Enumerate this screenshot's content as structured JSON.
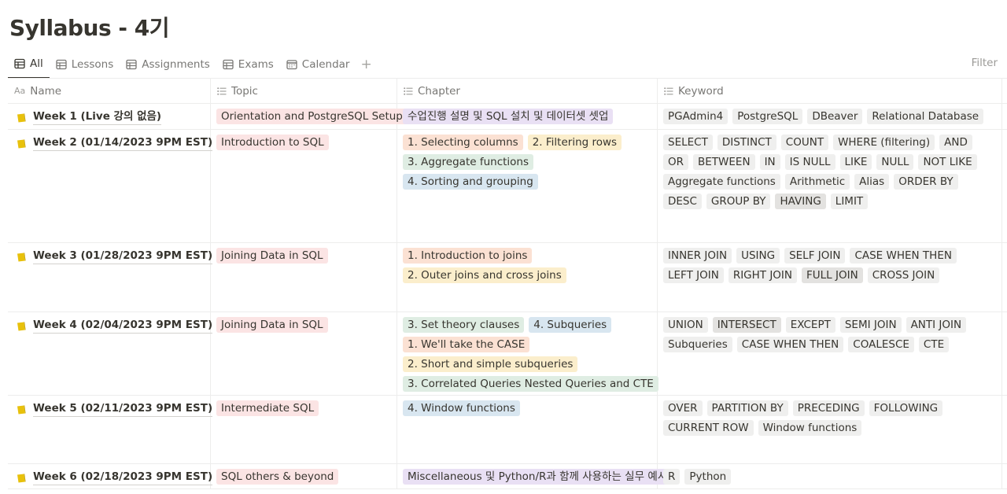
{
  "title": "Syllabus - 4기",
  "tabs": [
    {
      "label": "All",
      "icon": "table-icon",
      "active": true
    },
    {
      "label": "Lessons",
      "icon": "table-icon"
    },
    {
      "label": "Assignments",
      "icon": "table-icon"
    },
    {
      "label": "Exams",
      "icon": "table-icon"
    },
    {
      "label": "Calendar",
      "icon": "calendar-icon"
    }
  ],
  "add_view_label": "+",
  "filter_label": "Filter",
  "columns": {
    "name": {
      "label": "Name",
      "icon": "Aa"
    },
    "topic": {
      "label": "Topic",
      "icon": "list-icon"
    },
    "chapter": {
      "label": "Chapter",
      "icon": "list-icon"
    },
    "keyword": {
      "label": "Keyword",
      "icon": "list-icon"
    }
  },
  "colors": {
    "page_icon": "#e8c10c",
    "text": "#37352f",
    "muted": "#787774"
  },
  "rows": [
    {
      "name": "Week 1 (Live 강의 없음)",
      "topic": [
        {
          "label": "Orientation and PostgreSQL Setup",
          "color": "red"
        }
      ],
      "chapter": [
        {
          "label": "수업진행 설명 및 SQL 설치 및 데이터셋 셋업",
          "color": "purple"
        }
      ],
      "keywords": [
        {
          "label": "PGAdmin4",
          "color": "gray"
        },
        {
          "label": "PostgreSQL",
          "color": "gray"
        },
        {
          "label": "DBeaver",
          "color": "gray"
        },
        {
          "label": "Relational Database",
          "color": "gray"
        }
      ]
    },
    {
      "name": "Week 2 (01/14/2023 9PM EST)",
      "topic": [
        {
          "label": "Introduction to SQL",
          "color": "red"
        }
      ],
      "chapter": [
        {
          "label": "1. Selecting columns",
          "color": "orange"
        },
        {
          "label": "2. Filtering rows",
          "color": "yellow"
        },
        {
          "label": "3. Aggregate functions",
          "color": "green"
        },
        {
          "label": "4. Sorting and grouping",
          "color": "blue"
        }
      ],
      "keywords": [
        {
          "label": "SELECT",
          "color": "gray"
        },
        {
          "label": "DISTINCT",
          "color": "gray"
        },
        {
          "label": "COUNT",
          "color": "gray"
        },
        {
          "label": "WHERE (filtering)",
          "color": "gray"
        },
        {
          "label": "AND",
          "color": "gray"
        },
        {
          "label": "OR",
          "color": "gray"
        },
        {
          "label": "BETWEEN",
          "color": "gray"
        },
        {
          "label": "IN",
          "color": "gray"
        },
        {
          "label": "IS NULL",
          "color": "gray"
        },
        {
          "label": "LIKE",
          "color": "gray"
        },
        {
          "label": "NULL",
          "color": "gray"
        },
        {
          "label": "NOT LIKE",
          "color": "gray"
        },
        {
          "label": "Aggregate functions",
          "color": "gray"
        },
        {
          "label": "Arithmetic",
          "color": "gray"
        },
        {
          "label": "Alias",
          "color": "gray"
        },
        {
          "label": "ORDER BY",
          "color": "gray"
        },
        {
          "label": "DESC",
          "color": "gray"
        },
        {
          "label": "GROUP BY",
          "color": "gray"
        },
        {
          "label": "HAVING",
          "color": "darkgray"
        },
        {
          "label": "LIMIT",
          "color": "gray"
        }
      ]
    },
    {
      "name": "Week 3 (01/28/2023 9PM EST)",
      "topic": [
        {
          "label": "Joining Data in SQL",
          "color": "red"
        }
      ],
      "chapter": [
        {
          "label": "1. Introduction to joins",
          "color": "orange"
        },
        {
          "label": "2. Outer joins and cross joins",
          "color": "yellow"
        }
      ],
      "keywords": [
        {
          "label": "INNER JOIN",
          "color": "gray"
        },
        {
          "label": "USING",
          "color": "gray"
        },
        {
          "label": "SELF JOIN",
          "color": "gray"
        },
        {
          "label": "CASE WHEN THEN",
          "color": "gray"
        },
        {
          "label": "LEFT JOIN",
          "color": "gray"
        },
        {
          "label": "RIGHT JOIN",
          "color": "gray"
        },
        {
          "label": "FULL JOIN",
          "color": "darkgray"
        },
        {
          "label": "CROSS JOIN",
          "color": "gray"
        }
      ]
    },
    {
      "name": "Week 4 (02/04/2023 9PM EST)",
      "topic": [
        {
          "label": "Joining Data in SQL",
          "color": "red"
        }
      ],
      "chapter": [
        {
          "label": "3. Set theory clauses",
          "color": "green"
        },
        {
          "label": "4. Subqueries",
          "color": "blue"
        },
        {
          "label": "1. We'll take the CASE",
          "color": "orange"
        },
        {
          "label": "2. Short and simple subqueries",
          "color": "yellow"
        },
        {
          "label": "3. Correlated Queries Nested Queries and CTE",
          "color": "green"
        }
      ],
      "keywords": [
        {
          "label": "UNION",
          "color": "gray"
        },
        {
          "label": "INTERSECT",
          "color": "darkgray"
        },
        {
          "label": "EXCEPT",
          "color": "gray"
        },
        {
          "label": "SEMI JOIN",
          "color": "gray"
        },
        {
          "label": "ANTI JOIN",
          "color": "gray"
        },
        {
          "label": "Subqueries",
          "color": "gray"
        },
        {
          "label": "CASE WHEN THEN",
          "color": "gray"
        },
        {
          "label": "COALESCE",
          "color": "gray"
        },
        {
          "label": "CTE",
          "color": "gray"
        }
      ]
    },
    {
      "name": "Week 5 (02/11/2023 9PM EST)",
      "topic": [
        {
          "label": "Intermediate SQL",
          "color": "red"
        }
      ],
      "chapter": [
        {
          "label": "4. Window functions",
          "color": "blue"
        }
      ],
      "keywords": [
        {
          "label": "OVER",
          "color": "gray"
        },
        {
          "label": "PARTITION BY",
          "color": "gray"
        },
        {
          "label": "PRECEDING",
          "color": "gray"
        },
        {
          "label": "FOLLOWING",
          "color": "gray"
        },
        {
          "label": "CURRENT ROW",
          "color": "gray"
        },
        {
          "label": "Window functions",
          "color": "gray"
        }
      ]
    },
    {
      "name": "Week 6 (02/18/2023 9PM EST)",
      "topic": [
        {
          "label": "SQL others & beyond",
          "color": "red"
        }
      ],
      "chapter": [
        {
          "label": "Miscellaneous 및 Python/R과 함께 사용하는 실무 예시",
          "color": "purple"
        }
      ],
      "keywords": [
        {
          "label": "R",
          "color": "gray"
        },
        {
          "label": "Python",
          "color": "gray"
        }
      ]
    }
  ]
}
